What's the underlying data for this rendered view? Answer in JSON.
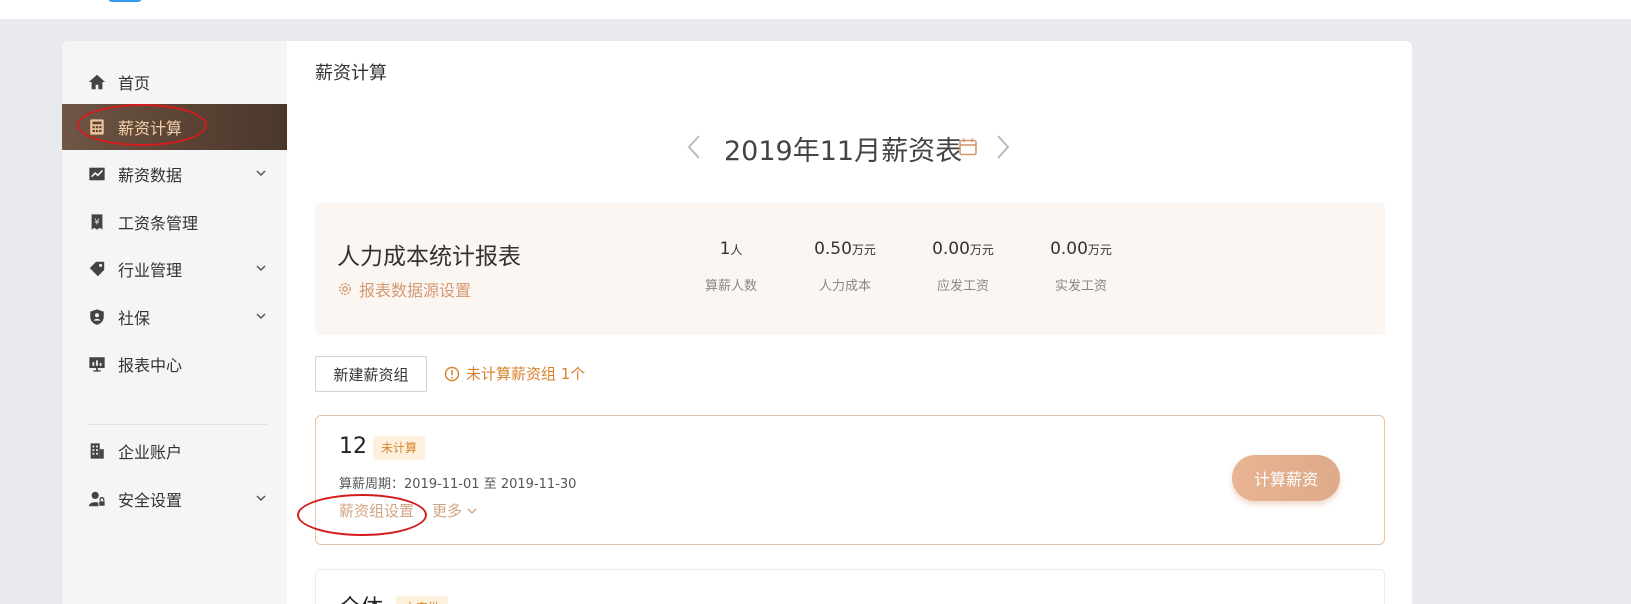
{
  "sidebar": {
    "items": [
      {
        "label": "首页",
        "icon": "home-icon"
      },
      {
        "label": "薪资计算",
        "icon": "calculator-icon",
        "active": true
      },
      {
        "label": "薪资数据",
        "icon": "chart-icon",
        "expandable": true
      },
      {
        "label": "工资条管理",
        "icon": "payslip-icon"
      },
      {
        "label": "行业管理",
        "icon": "tag-icon",
        "expandable": true
      },
      {
        "label": "社保",
        "icon": "shield-icon",
        "expandable": true
      },
      {
        "label": "报表中心",
        "icon": "monitor-icon"
      },
      {
        "label": "企业账户",
        "icon": "building-icon"
      },
      {
        "label": "安全设置",
        "icon": "user-lock-icon",
        "expandable": true
      }
    ]
  },
  "main": {
    "title": "薪资计算",
    "period_title": "2019年11月薪资表",
    "stats_card": {
      "title": "人力成本统计报表",
      "settings_link": "报表数据源设置",
      "stats": [
        {
          "value": "1",
          "unit": "人",
          "label": "算薪人数"
        },
        {
          "value": "0.50",
          "unit": "万元",
          "label": "人力成本"
        },
        {
          "value": "0.00",
          "unit": "万元",
          "label": "应发工资"
        },
        {
          "value": "0.00",
          "unit": "万元",
          "label": "实发工资"
        }
      ]
    },
    "new_group_button": "新建薪资组",
    "warning": "未计算薪资组 1个",
    "groups": [
      {
        "name": "12",
        "status": "未计算",
        "period_label": "算薪周期：2019-11-01 至 2019-11-30",
        "settings_link": "薪资组设置",
        "more_link": "更多",
        "action_button": "计算薪资"
      },
      {
        "name": "全体",
        "status": "未审批"
      }
    ]
  },
  "colors": {
    "accent": "#d39a72",
    "active_nav_bg": "#5a4334",
    "active_nav_text": "#f2cfa9",
    "warning": "#d8812d",
    "annotation": "#d41c1c"
  }
}
